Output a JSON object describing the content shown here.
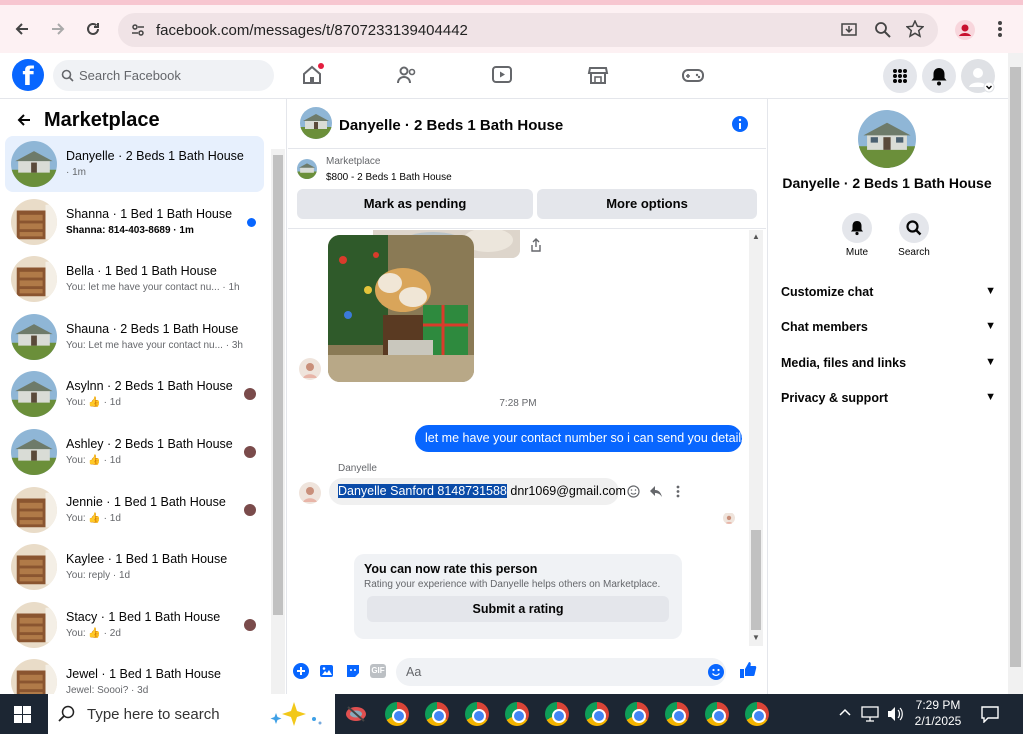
{
  "browser": {
    "url": "facebook.com/messages/t/8707233139404442"
  },
  "fb_header": {
    "logo": "f",
    "search_placeholder": "Search Facebook"
  },
  "left_panel": {
    "title": "Marketplace",
    "conversations": [
      {
        "title": "Danyelle · 2 Beds 1 Bath House",
        "subtitle": "· 1m",
        "active": true,
        "unread": false,
        "thumb": "house"
      },
      {
        "title": "Shanna · 1 Bed 1 Bath House",
        "subtitle": "Shanna: 814-403-8689 · 1m",
        "active": false,
        "unread": true,
        "thumb": "room"
      },
      {
        "title": "Bella · 1 Bed 1 Bath House",
        "subtitle": "You: let me have your contact nu... · 1h",
        "active": false,
        "unread": false,
        "thumb": "room"
      },
      {
        "title": "Shauna · 2 Beds 1 Bath House",
        "subtitle": "You: Let me have your contact nu... · 3h",
        "active": false,
        "unread": false,
        "thumb": "house"
      },
      {
        "title": "Asylnn · 2 Beds 1 Bath House",
        "subtitle": "You: 👍 · 1d",
        "active": false,
        "unread": false,
        "thumb": "house"
      },
      {
        "title": "Ashley · 2 Beds 1 Bath House",
        "subtitle": "You: 👍 · 1d",
        "active": false,
        "unread": false,
        "thumb": "house"
      },
      {
        "title": "Jennie · 1 Bed 1 Bath House",
        "subtitle": "You: 👍 · 1d",
        "active": false,
        "unread": false,
        "thumb": "room"
      },
      {
        "title": "Kaylee · 1 Bed 1 Bath House",
        "subtitle": "You: reply · 1d",
        "active": false,
        "unread": false,
        "thumb": "room"
      },
      {
        "title": "Stacy · 1 Bed 1 Bath House",
        "subtitle": "You: 👍 · 2d",
        "active": false,
        "unread": false,
        "thumb": "room"
      },
      {
        "title": "Jewel · 1 Bed 1 Bath House",
        "subtitle": "Jewel: Soooi? · 3d",
        "active": false,
        "unread": false,
        "thumb": "room"
      }
    ]
  },
  "chat": {
    "header_title": "Danyelle · 2 Beds 1 Bath House",
    "listing_source": "Marketplace",
    "listing_title": "$800 - 2 Beds 1 Bath House",
    "mark_pending_label": "Mark as pending",
    "more_options_label": "More options",
    "timestamp": "7:28 PM",
    "outgoing_message": "let me have your contact number so i can send you details",
    "sender_name": "Danyelle",
    "incoming_selected": "Danyelle Sanford 8148731588",
    "incoming_rest": " dnr1069@gmail.com",
    "rating_title": "You can now rate this person",
    "rating_desc": "Rating your experience with Danyelle helps others on Marketplace.",
    "rating_button": "Submit a rating",
    "composer_placeholder": "Aa",
    "gif_label": "GIF"
  },
  "right_panel": {
    "title": "Danyelle · 2 Beds 1 Bath House",
    "mute_label": "Mute",
    "search_label": "Search",
    "sections": [
      "Customize chat",
      "Chat members",
      "Media, files and links",
      "Privacy & support"
    ]
  },
  "taskbar": {
    "search_placeholder": "Type here to search",
    "time": "7:29 PM",
    "date": "2/1/2025",
    "pinned_browser_count": 10
  },
  "colors": {
    "fb_blue": "#0866ff",
    "active_conv_bg": "#e7f0fd",
    "taskbar_bg": "#1c2633"
  }
}
